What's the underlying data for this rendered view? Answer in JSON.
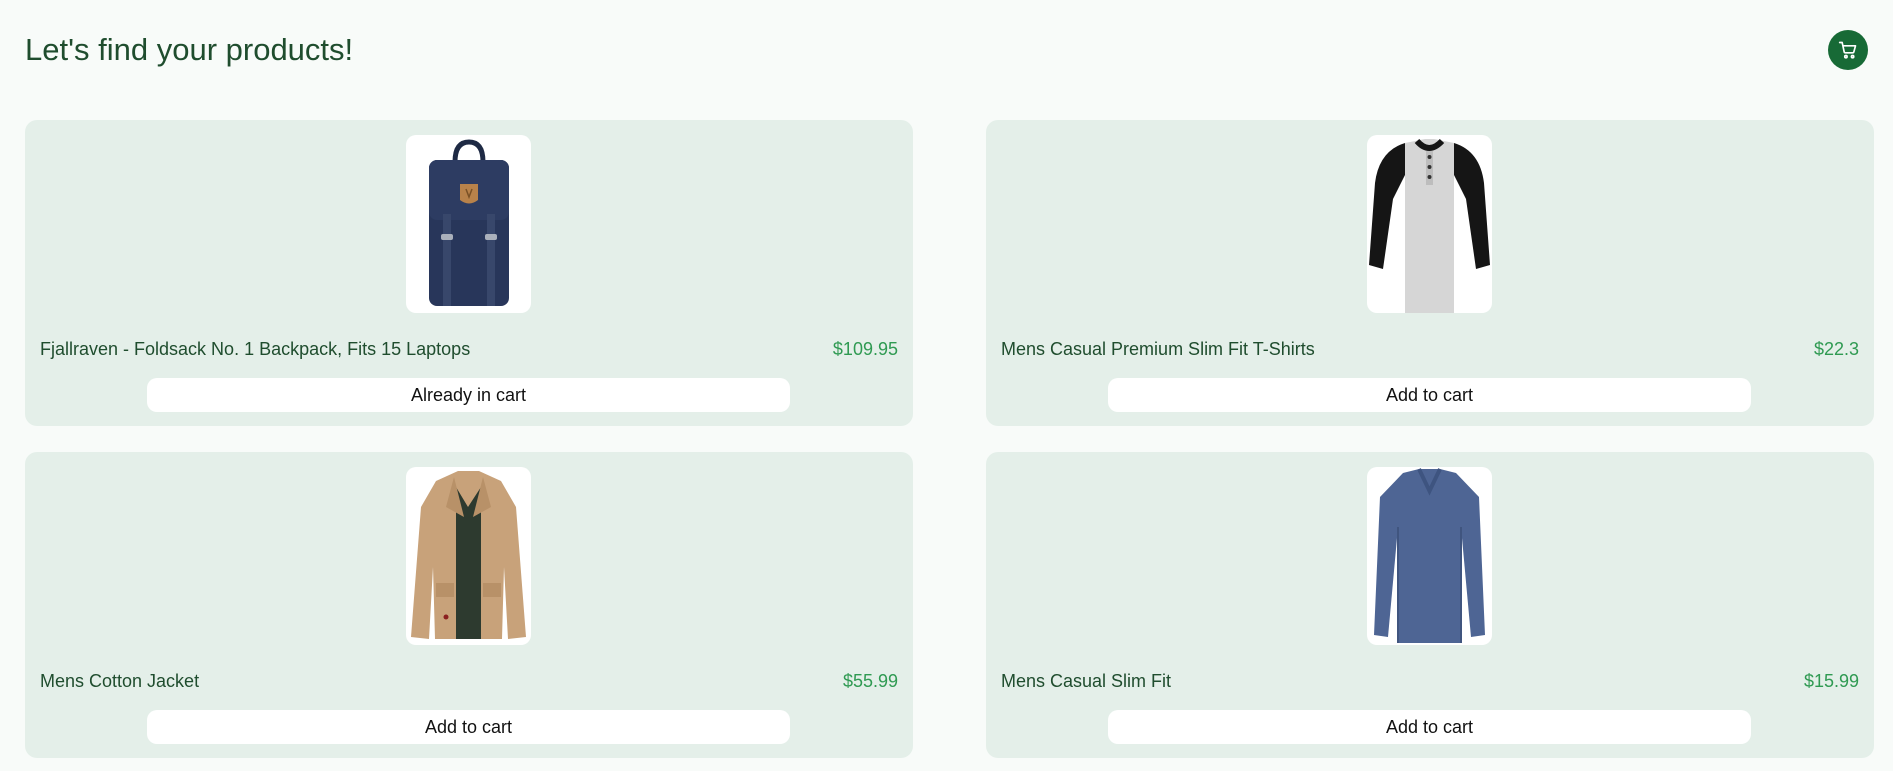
{
  "header": {
    "title": "Let's find your products!",
    "cart_icon": "cart-icon"
  },
  "colors": {
    "accent": "#176a36",
    "card_bg": "#e4efe9",
    "price": "#2f9a52",
    "title": "#1f4d2e"
  },
  "products": [
    {
      "name": "Fjallraven - Foldsack No. 1 Backpack, Fits 15 Laptops",
      "price": "$109.95",
      "button": "Already in cart",
      "image_icon": "backpack-image"
    },
    {
      "name": "Mens Casual Premium Slim Fit T-Shirts",
      "price": "$22.3",
      "button": "Add to cart",
      "image_icon": "tshirt-image"
    },
    {
      "name": "Mens Cotton Jacket",
      "price": "$55.99",
      "button": "Add to cart",
      "image_icon": "jacket-image"
    },
    {
      "name": "Mens Casual Slim Fit",
      "price": "$15.99",
      "button": "Add to cart",
      "image_icon": "longsleeve-image"
    }
  ]
}
